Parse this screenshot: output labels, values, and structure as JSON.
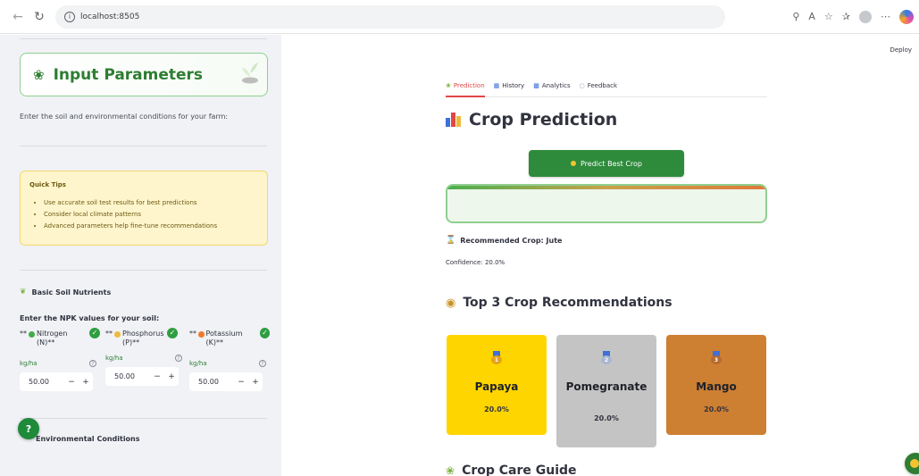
{
  "browser": {
    "url": "localhost:8505"
  },
  "sidebar": {
    "title": "Input Parameters",
    "description": "Enter the soil and environmental conditions for your farm:",
    "tips": {
      "heading": "Quick Tips",
      "items": [
        "Use accurate soil test results for best predictions",
        "Consider local climate patterns",
        "Advanced parameters help fine-tune recommendations"
      ]
    },
    "section_title": "Basic Soil Nutrients",
    "npk_label": "Enter the NPK values for your soil:",
    "nutrients": [
      {
        "prefix": "**",
        "name": "Nitrogen (N)**",
        "unit": "kg/ha",
        "value": "50.00",
        "color": "#3fae49"
      },
      {
        "prefix": "**",
        "name": "Phosphorus (P)**",
        "unit": "kg/ha",
        "value": "50.00",
        "color": "#f0b93a"
      },
      {
        "prefix": "**",
        "name": "Potassium (K)**",
        "unit": "kg/ha",
        "value": "50.00",
        "color": "#f07a2b"
      }
    ],
    "env_title": "Environmental Conditions",
    "help_label": "?"
  },
  "header": {
    "deploy_label": "Deploy"
  },
  "tabs": [
    {
      "label": "Prediction",
      "icon": "seedling-icon",
      "active": true
    },
    {
      "label": "History",
      "icon": "books-icon",
      "active": false
    },
    {
      "label": "Analytics",
      "icon": "bar-chart-icon",
      "active": false
    },
    {
      "label": "Feedback",
      "icon": "chat-icon",
      "active": false
    }
  ],
  "main": {
    "title": "Crop Prediction",
    "predict_button": "Predict Best Crop",
    "recommended": "Recommended Crop: Jute",
    "confidence": "Confidence: 20.0%",
    "top3_title": "Top 3 Crop Recommendations",
    "care_title": "Crop Care Guide",
    "cards": [
      {
        "rank": "1",
        "name": "Papaya",
        "pct": "20.0%",
        "color": "#ffd500",
        "medal": "#e3a21a"
      },
      {
        "rank": "2",
        "name": "Pomegranate",
        "pct": "20.0%",
        "color": "#c4c4c4",
        "medal": "#a9b6d0"
      },
      {
        "rank": "3",
        "name": "Mango",
        "pct": "20.0%",
        "color": "#cd7f32",
        "medal": "#b8692e"
      }
    ]
  }
}
